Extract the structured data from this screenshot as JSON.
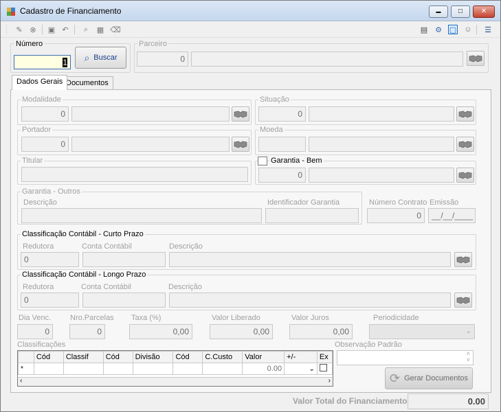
{
  "window": {
    "title": "Cadastro de Financiamento",
    "minimize_glyph": "▬",
    "maximize_glyph": "□",
    "close_glyph": "✕"
  },
  "header": {
    "numero_label": "Número",
    "numero_value": "1",
    "buscar_label": "Buscar",
    "parceiro_label": "Parceiro",
    "parceiro_code": "0",
    "parceiro_name": ""
  },
  "tabs": [
    {
      "label": "Dados Gerais",
      "active": true
    },
    {
      "label": "Documentos",
      "active": false
    }
  ],
  "dados": {
    "modalidade_label": "Modalidade",
    "modalidade_code": "0",
    "situacao_label": "Situação",
    "situacao_code": "0",
    "portador_label": "Portador",
    "portador_code": "0",
    "moeda_label": "Moeda",
    "titular_label": "Titular",
    "garantia_bem_label": "Garantia - Bem",
    "garantia_bem_code": "0",
    "garantia_outros_label": "Garantia - Outros",
    "descricao_label": "Descrição",
    "identificador_label": "Identificador Garantia",
    "numero_contrato_label": "Número Contrato",
    "numero_contrato_value": "0",
    "emissao_label": "Emissão",
    "emissao_value": "__/__/____"
  },
  "curto_prazo": {
    "title": "Classificação Contábil - Curto Prazo",
    "redutora_label": "Redutora",
    "redutora_value": "0",
    "conta_label": "Conta Contábil",
    "descricao_label": "Descrição"
  },
  "longo_prazo": {
    "title": "Classificação Contábil - Longo Prazo",
    "redutora_label": "Redutora",
    "redutora_value": "0",
    "conta_label": "Conta Contábil",
    "descricao_label": "Descrição"
  },
  "parcelas": {
    "dia_venc_label": "Dia Venc.",
    "dia_venc_value": "0",
    "nro_parcelas_label": "Nro.Parcelas",
    "nro_parcelas_value": "0",
    "taxa_label": "Taxa (%)",
    "taxa_value": "0,00",
    "valor_liberado_label": "Valor Liberado",
    "valor_liberado_value": "0,00",
    "valor_juros_label": "Valor Juros",
    "valor_juros_value": "0,00",
    "periodicidade_label": "Periodicidade"
  },
  "classificacoes": {
    "label": "Classificações",
    "columns": [
      "Cód",
      "Classif",
      "Cód",
      "Divisão",
      "Cód",
      "C.Custo",
      "Valor",
      "+/-",
      "Ex"
    ],
    "new_row_marker": "*",
    "new_row_valor": "0.00"
  },
  "observacao_label": "Observação Padrão",
  "gerar_label": "Gerar Documentos",
  "footer": {
    "total_label": "Valor Total do Financiamento",
    "total_value": "0.00"
  }
}
